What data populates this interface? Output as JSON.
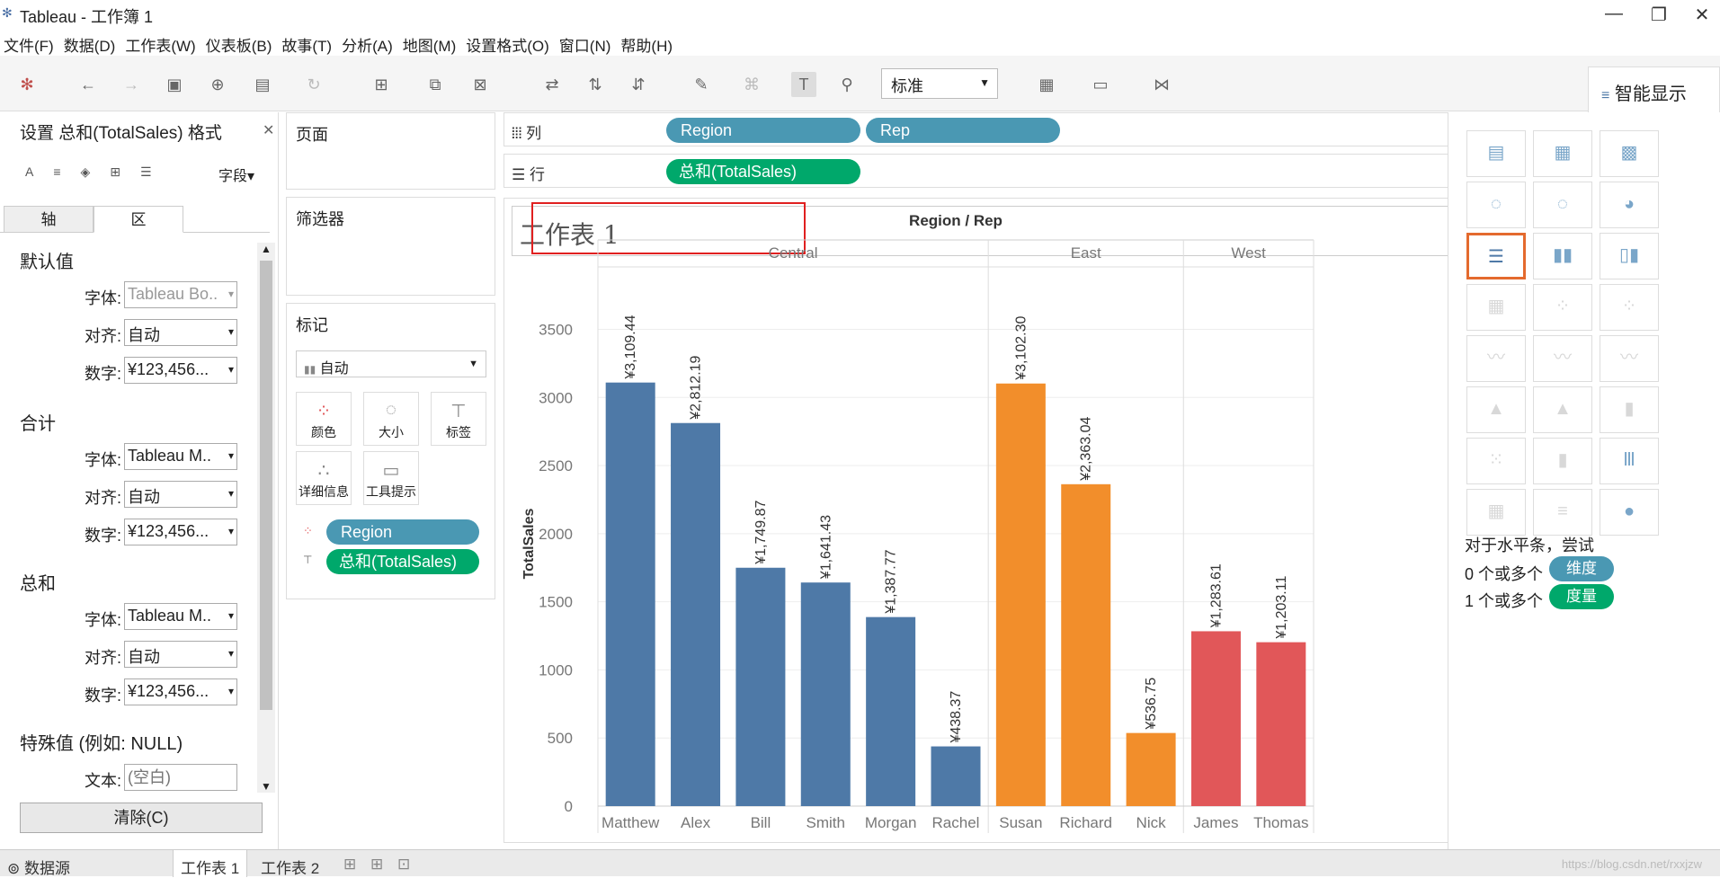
{
  "window": {
    "app_title": "Tableau - 工作簿 1",
    "min": "—",
    "max": "❐",
    "close": "✕"
  },
  "menu": [
    "文件(F)",
    "数据(D)",
    "工作表(W)",
    "仪表板(B)",
    "故事(T)",
    "分析(A)",
    "地图(M)",
    "设置格式(O)",
    "窗口(N)",
    "帮助(H)"
  ],
  "toolbar": {
    "view_select": "标准",
    "smart_show_label": "智能显示"
  },
  "format_panel": {
    "title": "设置 总和(TotalSales) 格式",
    "fields_label": "字段",
    "tabs": [
      "轴",
      "区"
    ],
    "sections": {
      "default": {
        "title": "默认值",
        "font_label": "字体:",
        "font": "Tableau Bo..",
        "align_label": "对齐:",
        "align": "自动",
        "num_label": "数字:",
        "num": "¥123,456..."
      },
      "total": {
        "title": "合计",
        "font_label": "字体:",
        "font": "Tableau M..",
        "align_label": "对齐:",
        "align": "自动",
        "num_label": "数字:",
        "num": "¥123,456..."
      },
      "grand": {
        "title": "总和",
        "font_label": "字体:",
        "font": "Tableau M..",
        "align_label": "对齐:",
        "align": "自动",
        "num_label": "数字:",
        "num": "¥123,456..."
      },
      "special": {
        "title": "特殊值 (例如: NULL)",
        "text_label": "文本:",
        "text_placeholder": "(空白)"
      }
    },
    "clear_button": "清除(C)"
  },
  "cards": {
    "pages": "页面",
    "filters": "筛选器",
    "marks": "标记",
    "mark_type": "自动",
    "mark_buttons": [
      "颜色",
      "大小",
      "标签",
      "详细信息",
      "工具提示"
    ],
    "mark_pills": [
      "Region",
      "总和(TotalSales)"
    ]
  },
  "shelves": {
    "columns_label": "列",
    "rows_label": "行",
    "column_pills": [
      "Region",
      "Rep"
    ],
    "row_pills": [
      "总和(TotalSales)"
    ]
  },
  "sheet_title": "工作表 1",
  "chart_data": {
    "type": "bar",
    "title": "Region / Rep",
    "ylabel": "TotalSales",
    "ylim": [
      0,
      3800
    ],
    "yticks": [
      0,
      500,
      1000,
      1500,
      2000,
      2500,
      3000,
      3500
    ],
    "groups": [
      {
        "name": "Central",
        "color": "#4e79a7"
      },
      {
        "name": "East",
        "color": "#f28e2b"
      },
      {
        "name": "West",
        "color": "#e15759"
      }
    ],
    "categories": [
      "Matthew",
      "Alex",
      "Bill",
      "Smith",
      "Morgan",
      "Rachel",
      "Susan",
      "Richard",
      "Nick",
      "James",
      "Thomas"
    ],
    "group_of": [
      0,
      0,
      0,
      0,
      0,
      0,
      1,
      1,
      1,
      2,
      2
    ],
    "values": [
      3109.44,
      2812.19,
      1749.87,
      1641.43,
      1387.77,
      438.37,
      3102.3,
      2363.04,
      536.75,
      1283.61,
      1203.11
    ],
    "labels": [
      "¥3,109.44",
      "¥2,812.19",
      "¥1,749.87",
      "¥1,641.43",
      "¥1,387.77",
      "¥438.37",
      "¥3,102.30",
      "¥2,363.04",
      "¥536.75",
      "¥1,283.61",
      "¥1,203.11"
    ],
    "grid": true
  },
  "smart_show": {
    "hint": "对于水平条，尝试",
    "dim_prefix": "0 个或多个",
    "dim_pill": "维度",
    "meas_prefix": "1 个或多个",
    "meas_pill": "度量"
  },
  "bottom_tabs": {
    "datasource": "数据源",
    "sheet1": "工作表 1",
    "sheet2": "工作表 2"
  },
  "watermark": "https://blog.csdn.net/rxxjzw"
}
